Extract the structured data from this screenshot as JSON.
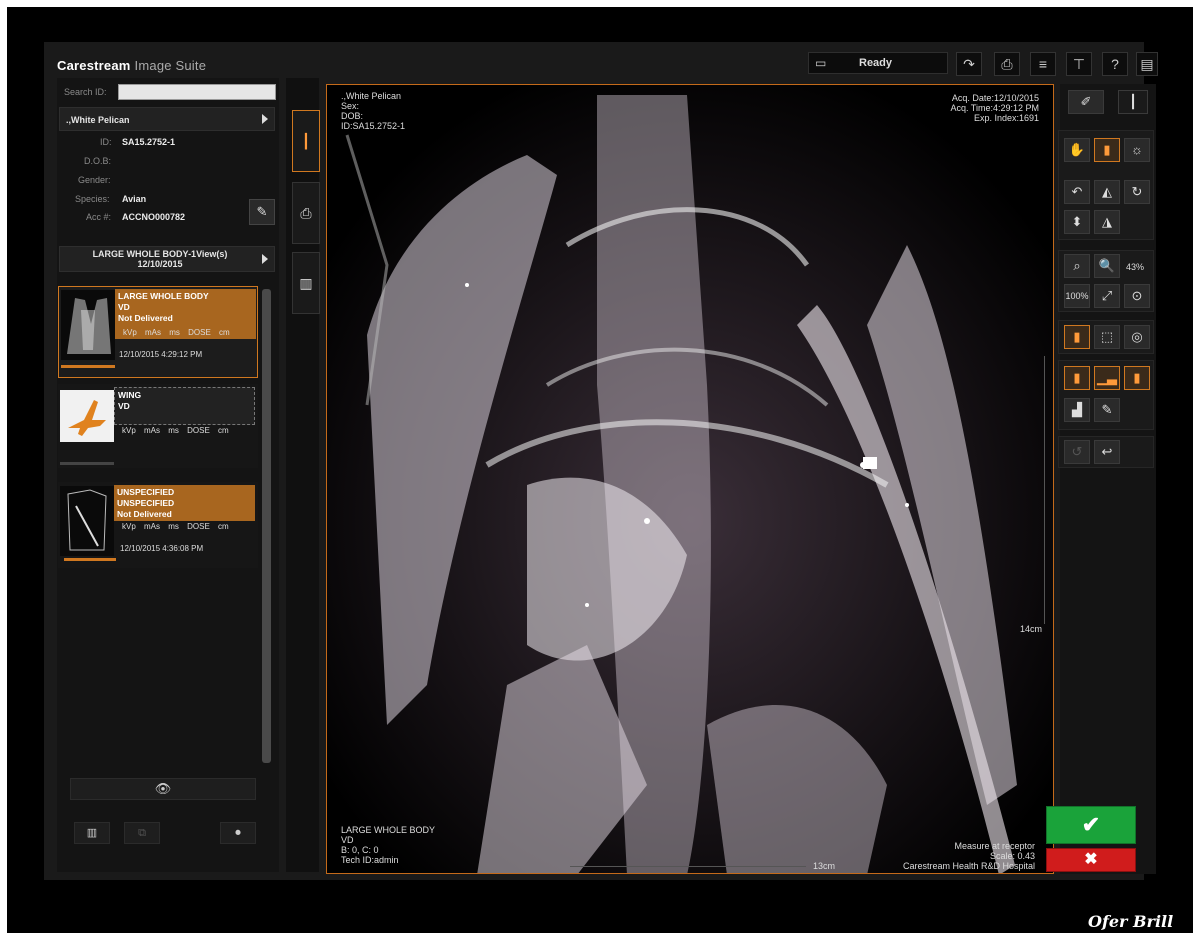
{
  "app": {
    "brand": "Carestream",
    "suite": "Image Suite",
    "status": "Ready"
  },
  "search": {
    "label": "Search ID:",
    "value": ""
  },
  "patient": {
    "name": ".,White Pelican",
    "fields": [
      {
        "label": "ID:",
        "value": "SA15.2752-1"
      },
      {
        "label": "D.O.B:",
        "value": ""
      },
      {
        "label": "Gender:",
        "value": ""
      },
      {
        "label": "Species:",
        "value": "Avian"
      },
      {
        "label": "Acc #:",
        "value": "ACCNO000782"
      }
    ]
  },
  "study": {
    "title": "LARGE WHOLE BODY-1View(s)",
    "date": "12/10/2015"
  },
  "images": [
    {
      "title": "LARGE WHOLE BODY",
      "view": "VD",
      "status": "Not Delivered",
      "params": "kVp mAs ms DOSE cm",
      "timestamp": "12/10/2015 4:29:12 PM",
      "selected": true
    },
    {
      "title": "WING",
      "view": "VD",
      "status": "",
      "params": "kVp mAs ms DOSE cm",
      "timestamp": "",
      "selected": false
    },
    {
      "title": "UNSPECIFIED",
      "view": "UNSPECIFIED",
      "status": "Not Delivered",
      "params": "kVp mAs ms DOSE cm",
      "timestamp": "12/10/2015 4:36:08 PM",
      "selected": false
    }
  ],
  "overlay": {
    "top_left": [
      ".,White Pelican",
      "Sex:",
      "DOB:",
      "ID:SA15.2752-1"
    ],
    "top_right": [
      "Acq. Date:12/10/2015",
      "Acq. Time:4:29:12 PM",
      "Exp. Index:1691"
    ],
    "bottom_left": [
      "LARGE WHOLE BODY",
      "VD",
      "B: 0, C: 0",
      "Tech ID:admin"
    ],
    "bottom_right": [
      "Measure at receptor",
      "Scale: 0.43",
      "Carestream Health R&D Hospital"
    ],
    "scale_right": "14cm",
    "scale_bottom": "13cm"
  },
  "tools": {
    "zoom_percent": "43%",
    "zoom_100": "100%"
  },
  "credit": "Ofer Brill",
  "colors": {
    "accent": "#d07820",
    "ok": "#1aa33a",
    "cancel": "#d01c1c"
  }
}
